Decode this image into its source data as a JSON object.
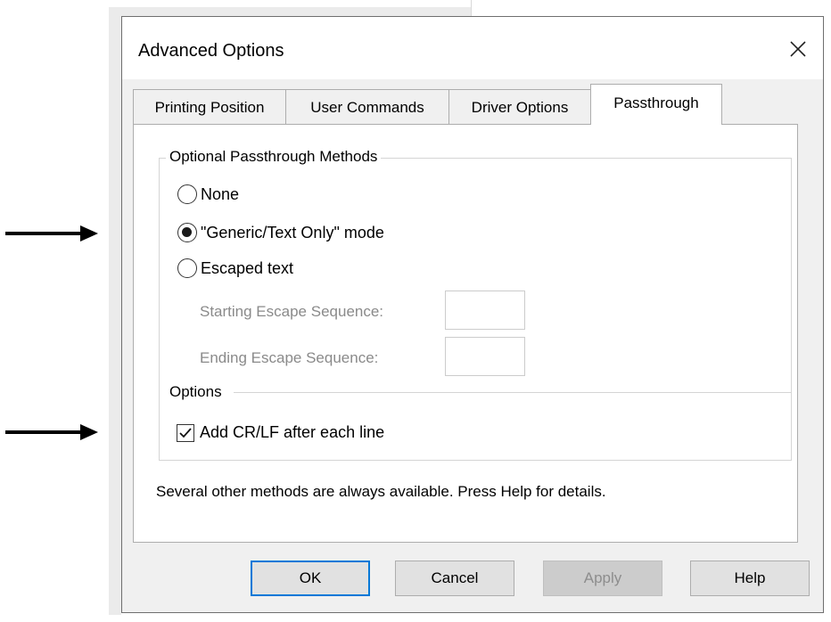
{
  "dialog": {
    "title": "Advanced Options",
    "close_icon": "close-x-icon"
  },
  "tabs": [
    {
      "label": "Printing Position",
      "active": false
    },
    {
      "label": "User Commands",
      "active": false
    },
    {
      "label": "Driver Options",
      "active": false
    },
    {
      "label": "Passthrough",
      "active": true
    }
  ],
  "passthrough": {
    "methods_group_label": "Optional Passthrough Methods",
    "methods": [
      {
        "label": "None",
        "selected": false
      },
      {
        "label": "\"Generic/Text Only\" mode",
        "selected": true
      },
      {
        "label": "Escaped text",
        "selected": false
      }
    ],
    "starting_escape_label": "Starting Escape Sequence:",
    "starting_escape_value": "",
    "ending_escape_label": "Ending Escape Sequence:",
    "ending_escape_value": "",
    "options_group_label": "Options",
    "add_crlf_label": "Add CR/LF after each line",
    "add_crlf_checked": true,
    "info_text": "Several other methods are always available. Press Help for details."
  },
  "buttons": {
    "ok": "OK",
    "cancel": "Cancel",
    "apply": "Apply",
    "help": "Help"
  },
  "annotations": {
    "arrow_icon": "right-arrow-icon"
  }
}
